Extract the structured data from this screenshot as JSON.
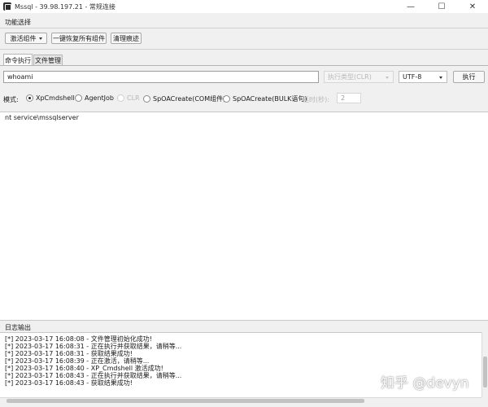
{
  "window": {
    "title": "Mssql - 39.98.197.21 - 常规连接",
    "minimize_glyph": "—",
    "maximize_glyph": "☐",
    "close_glyph": "✕"
  },
  "function_group": {
    "label": "功能选择",
    "activate_button": "激活组件",
    "restore_all_button": "一键恢复所有组件",
    "clear_traces_button": "清理痕迹"
  },
  "tabs": [
    {
      "label": "命令执行",
      "active": true
    },
    {
      "label": "文件管理",
      "active": false
    }
  ],
  "command": {
    "input_value": "whoami",
    "exec_type_placeholder": "执行类型(CLR)",
    "encoding_value": "UTF-8",
    "execute_button": "执行"
  },
  "mode": {
    "label": "模式:",
    "options": [
      {
        "label": "XpCmdshell",
        "checked": true,
        "disabled": false
      },
      {
        "label": "AgentJob",
        "checked": false,
        "disabled": false
      },
      {
        "label": "CLR",
        "checked": false,
        "disabled": true
      },
      {
        "label": "SpOACreate(COM组件)",
        "checked": false,
        "disabled": false
      },
      {
        "label": "SpOACreate(BULK语句)",
        "checked": false,
        "disabled": false
      }
    ],
    "delay_label": "延时(秒):",
    "delay_value": "2"
  },
  "output": {
    "text": "nt service\\mssqlserver"
  },
  "log": {
    "header": "日志输出",
    "lines": [
      "[*] 2023-03-17 16:08:08 - 文件管理初始化成功!",
      "[*] 2023-03-17 16:08:31 - 正在执行并获取结果，请稍等...",
      "[*] 2023-03-17 16:08:31 - 获取结果成功!",
      "[*] 2023-03-17 16:08:39 - 正在激活，请稍等...",
      "[*] 2023-03-17 16:08:40 - XP_Cmdshell 激活成功!",
      "[*] 2023-03-17 16:08:43 - 正在执行并获取结果，请稍等...",
      "[*] 2023-03-17 16:08:43 - 获取结果成功!"
    ]
  },
  "watermark": "知乎 @devyn"
}
